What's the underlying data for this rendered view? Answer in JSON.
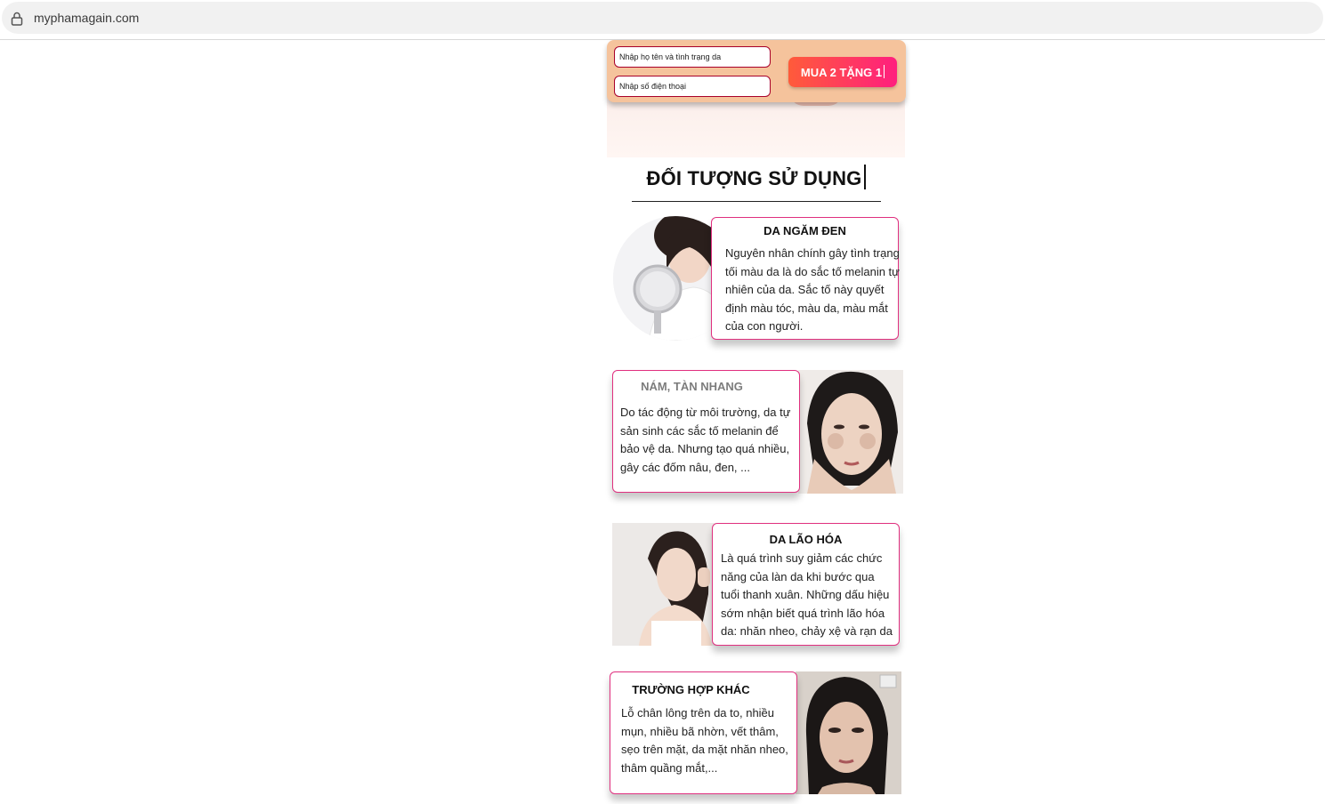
{
  "browser": {
    "url": "myphamagain.com",
    "lock_icon": "lock-icon"
  },
  "order_bar": {
    "name_placeholder": "Nhập họ tên và tình trạng da",
    "phone_placeholder": "Nhập số điện thoại",
    "button_label": "MUA 2 TẶNG 1"
  },
  "section": {
    "title": "ĐỐI TƯỢNG SỬ DỤNG"
  },
  "cards": [
    {
      "title": "DA NGĂM ĐEN",
      "text": "Nguyên nhân chính gây tình trạng tối màu da là do sắc tố melanin tự nhiên của da. Sắc tố này quyết định màu tóc, màu da, màu mắt của con người."
    },
    {
      "title": "NÁM, TÀN NHANG",
      "text": "Do tác động từ môi trường, da tự sản sinh các sắc tố melanin để bảo vệ da. Nhưng tạo quá nhiều, gây các đốm nâu, đen, ..."
    },
    {
      "title": "DA LÃO HÓA",
      "text": "Là quá trình suy giảm các chức năng của làn da khi bước qua tuổi thanh xuân. Những dấu hiệu sớm nhận biết quá trình lão hóa da: nhăn nheo, chảy xệ và rạn da"
    },
    {
      "title": "TRƯỜNG HỢP KHÁC",
      "text": "Lỗ chân lông trên da to, nhiều mụn, nhiều bã nhờn, vết thâm, sẹo trên mặt, da mặt nhăn nheo, thâm quầng mắt,..."
    }
  ],
  "colors": {
    "accent": "#e0307f",
    "order_bar_bg": "#f5c39c",
    "button_from": "#ff5b3a",
    "button_to": "#ff1f7e"
  }
}
